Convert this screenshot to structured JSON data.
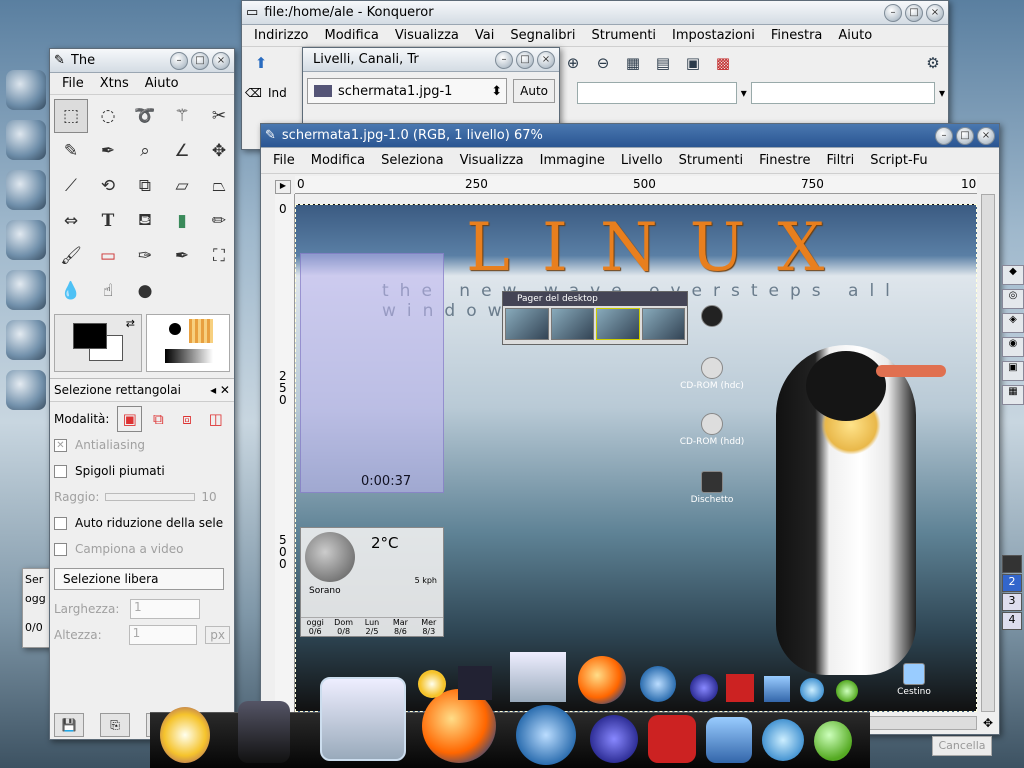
{
  "konqueror": {
    "title": "file:/home/ale - Konqueror",
    "menu": [
      "Indirizzo",
      "Modifica",
      "Visualizza",
      "Vai",
      "Segnalibri",
      "Strumenti",
      "Impostazioni",
      "Finestra",
      "Aiuto"
    ],
    "location_label": "Ind"
  },
  "toolbox": {
    "title": "The",
    "menu": [
      "File",
      "Xtns",
      "Aiuto"
    ],
    "tool_options_title": "Selezione rettangolai",
    "mode_label": "Modalità:",
    "antialiasing": "Antialiasing",
    "feather": "Spigoli piumati",
    "radius": "Raggio:",
    "radius_value": "10",
    "autoshrink": "Auto riduzione della sele",
    "sample_merged": "Campiona a video",
    "selection_combo": "Selezione libera",
    "width_label": "Larghezza:",
    "width_value": "1",
    "height_label": "Altezza:",
    "height_value": "1",
    "unit": "px"
  },
  "layers": {
    "title": "Livelli, Canali, Tr",
    "image_combo": "schermata1.jpg-1",
    "auto_button": "Auto"
  },
  "image_window": {
    "title": "schermata1.jpg-1.0 (RGB, 1 livello) 67%",
    "menu": [
      "File",
      "Modifica",
      "Seleziona",
      "Visualizza",
      "Immagine",
      "Livello",
      "Strumenti",
      "Finestre",
      "Filtri",
      "Script-Fu"
    ],
    "ruler_h": [
      "0",
      "250",
      "500",
      "750",
      "10"
    ],
    "ruler_v": [
      "0",
      "2 5 0",
      "5 0 0"
    ]
  },
  "canvas": {
    "headline": "LINUX",
    "tagline": "the new wave oversteps all windows",
    "pager_title": "Pager del desktop",
    "timer": "0:00:37",
    "weather": {
      "temp": "2°C",
      "wind": "5 kph",
      "city": "Sorano",
      "days": [
        "oggi",
        "Dom",
        "Lun",
        "Mar",
        "Mer"
      ],
      "temps": [
        "0/6",
        "0/8",
        "2/5",
        "8/6",
        "8/3"
      ]
    },
    "desktop_icons": [
      "CD-ROM (hdc)",
      "CD-ROM (hdd)",
      "Dischetto",
      "Cestino"
    ]
  },
  "left_window": {
    "label1": "Ser",
    "label2": "ogg",
    "label3": "0/0"
  },
  "pager_numbers": [
    "2",
    "3",
    "4"
  ],
  "cancel_label": "Cancella"
}
